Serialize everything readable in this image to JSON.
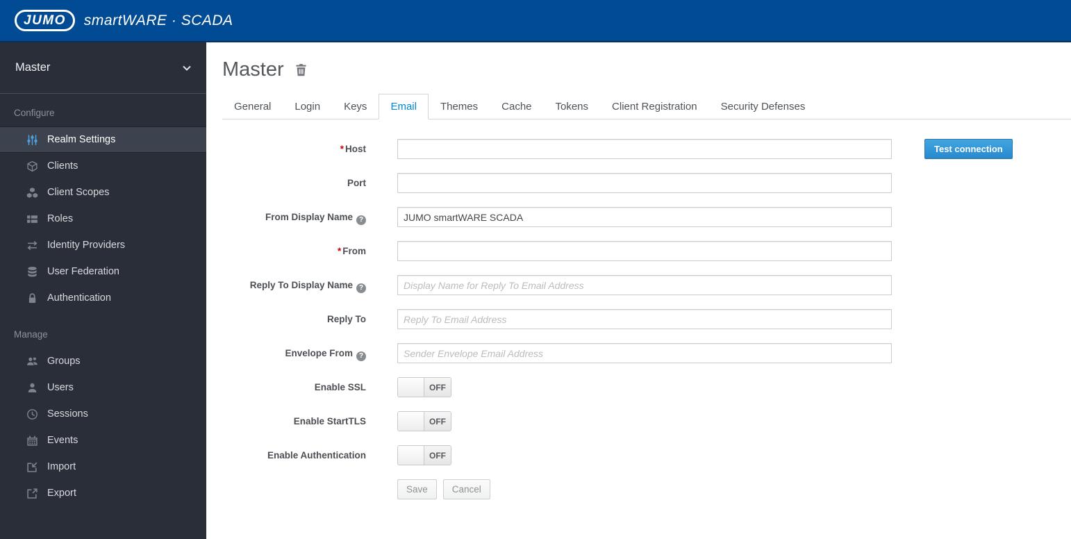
{
  "header": {
    "brand_logo": "JUMO",
    "brand_product": "smartWARE · SCADA"
  },
  "sidebar": {
    "realm_selector": {
      "label": "Master",
      "icon": "chevron-down"
    },
    "sections": [
      {
        "label": "Configure",
        "items": [
          {
            "label": "Realm Settings",
            "icon": "sliders",
            "active": true
          },
          {
            "label": "Clients",
            "icon": "cube",
            "active": false
          },
          {
            "label": "Client Scopes",
            "icon": "cubes",
            "active": false
          },
          {
            "label": "Roles",
            "icon": "list-blocks",
            "active": false
          },
          {
            "label": "Identity Providers",
            "icon": "exchange-arrows",
            "active": false
          },
          {
            "label": "User Federation",
            "icon": "database",
            "active": false
          },
          {
            "label": "Authentication",
            "icon": "lock",
            "active": false
          }
        ]
      },
      {
        "label": "Manage",
        "items": [
          {
            "label": "Groups",
            "icon": "users-group",
            "active": false
          },
          {
            "label": "Users",
            "icon": "user",
            "active": false
          },
          {
            "label": "Sessions",
            "icon": "clock",
            "active": false
          },
          {
            "label": "Events",
            "icon": "calendar",
            "active": false
          },
          {
            "label": "Import",
            "icon": "import-arrow",
            "active": false
          },
          {
            "label": "Export",
            "icon": "export-arrow",
            "active": false
          }
        ]
      }
    ]
  },
  "main": {
    "title": "Master",
    "title_action_icon": "trash",
    "tabs": [
      {
        "label": "General",
        "active": false
      },
      {
        "label": "Login",
        "active": false
      },
      {
        "label": "Keys",
        "active": false
      },
      {
        "label": "Email",
        "active": true
      },
      {
        "label": "Themes",
        "active": false
      },
      {
        "label": "Cache",
        "active": false
      },
      {
        "label": "Tokens",
        "active": false
      },
      {
        "label": "Client Registration",
        "active": false
      },
      {
        "label": "Security Defenses",
        "active": false
      }
    ],
    "form": {
      "required_marker": "*",
      "help_glyph": "?",
      "fields": [
        {
          "label": "Host",
          "required": true,
          "help": false,
          "value": "",
          "placeholder": ""
        },
        {
          "label": "Port",
          "required": false,
          "help": false,
          "value": "",
          "placeholder": ""
        },
        {
          "label": "From Display Name",
          "required": false,
          "help": true,
          "value": "JUMO smartWARE SCADA",
          "placeholder": ""
        },
        {
          "label": "From",
          "required": true,
          "help": false,
          "value": "",
          "placeholder": ""
        },
        {
          "label": "Reply To Display Name",
          "required": false,
          "help": true,
          "value": "",
          "placeholder": "Display Name for Reply To Email Address"
        },
        {
          "label": "Reply To",
          "required": false,
          "help": false,
          "value": "",
          "placeholder": "Reply To Email Address"
        },
        {
          "label": "Envelope From",
          "required": false,
          "help": true,
          "value": "",
          "placeholder": "Sender Envelope Email Address"
        }
      ],
      "test_connection_label": "Test connection",
      "toggles": [
        {
          "label": "Enable SSL",
          "state": "OFF"
        },
        {
          "label": "Enable StartTLS",
          "state": "OFF"
        },
        {
          "label": "Enable Authentication",
          "state": "OFF"
        }
      ],
      "buttons": {
        "save": "Save",
        "cancel": "Cancel"
      }
    }
  },
  "colors": {
    "header_blue": "#004b93",
    "sidebar_bg": "#292e38",
    "sidebar_active_bg": "#3d434e",
    "active_icon_blue": "#4aa3e0",
    "active_tab_blue": "#0088ce",
    "primary_button_blue": "#2e94d2",
    "required_red": "#cc0000"
  }
}
